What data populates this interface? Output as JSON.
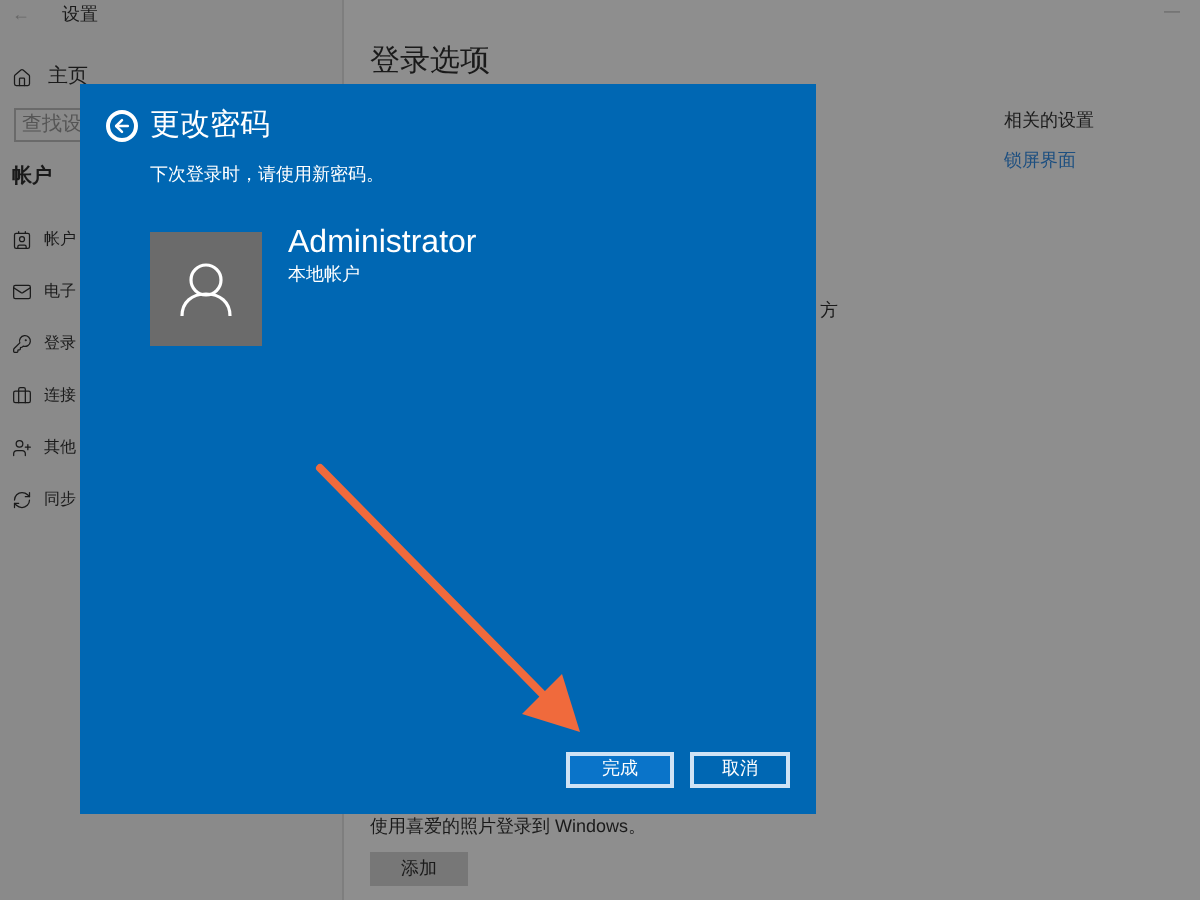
{
  "window": {
    "back": "←",
    "title": "设置",
    "minimize": "—"
  },
  "sidebar": {
    "home": "主页",
    "search": {
      "placeholder": "查找设"
    },
    "section": "帐户",
    "items": [
      {
        "kind": "info",
        "label": "帐户"
      },
      {
        "kind": "mail",
        "label": "电子"
      },
      {
        "kind": "key",
        "label": "登录"
      },
      {
        "kind": "work",
        "label": "连接"
      },
      {
        "kind": "person",
        "label": "其他"
      },
      {
        "kind": "sync",
        "label": "同步"
      }
    ]
  },
  "main": {
    "title": "登录选项",
    "fragment": "方",
    "related_title": "相关的设置",
    "related_link": "锁屏界面",
    "picture_text": "使用喜爱的照片登录到 Windows。",
    "add_button": "添加"
  },
  "dialog": {
    "title": "更改密码",
    "subtitle": "下次登录时，请使用新密码。",
    "user_name": "Administrator",
    "account_type": "本地帐户",
    "buttons": [
      {
        "label": "完成",
        "selected": true
      },
      {
        "label": "取消",
        "selected": false
      }
    ]
  }
}
